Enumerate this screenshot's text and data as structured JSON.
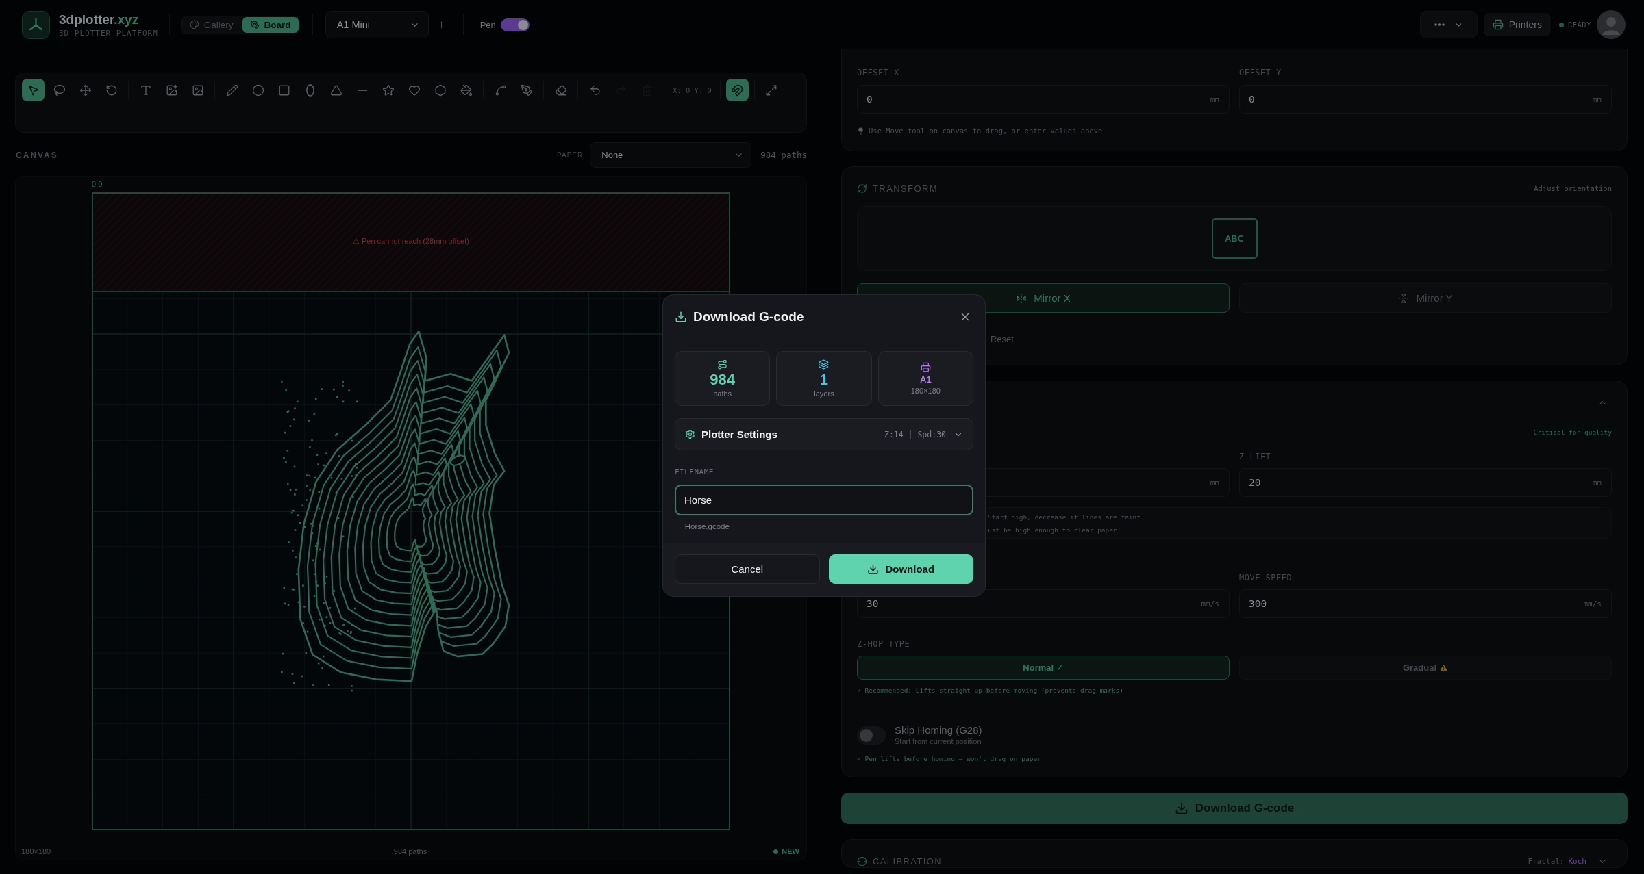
{
  "header": {
    "brand": {
      "name": "3dplotter",
      "suffix": ".xyz",
      "tagline": "3D PLOTTER PLATFORM"
    },
    "view_tabs": [
      {
        "label": "Gallery",
        "selected": false
      },
      {
        "label": "Board",
        "selected": true
      }
    ],
    "printer_select": {
      "value": "A1 Mini"
    },
    "pen": {
      "label": "Pen",
      "on": true
    },
    "printers_button": {
      "label": "Printers"
    },
    "status": {
      "label": "READY"
    }
  },
  "toolbar": {
    "groups": [
      {
        "kind": "tools",
        "tools": [
          {
            "selected": true,
            "disabled": false
          },
          {
            "selected": false,
            "disabled": false
          },
          {
            "selected": false,
            "disabled": false
          },
          {
            "selected": false,
            "disabled": false
          }
        ]
      },
      {
        "kind": "tools",
        "tools": [
          {
            "selected": false,
            "disabled": false
          },
          {
            "selected": false,
            "disabled": false
          },
          {
            "selected": false,
            "disabled": false
          }
        ]
      },
      {
        "kind": "tools",
        "tools": [
          {
            "selected": false,
            "disabled": false
          },
          {
            "selected": false,
            "disabled": false
          },
          {
            "selected": false,
            "disabled": false
          },
          {
            "selected": false,
            "disabled": false
          },
          {
            "selected": false,
            "disabled": false
          },
          {
            "selected": false,
            "disabled": false
          },
          {
            "selected": false,
            "disabled": false
          },
          {
            "selected": false,
            "disabled": false
          },
          {
            "selected": false,
            "disabled": false
          },
          {
            "selected": false,
            "disabled": false
          }
        ]
      },
      {
        "kind": "tools",
        "tools": [
          {
            "selected": false,
            "disabled": false
          },
          {
            "selected": false,
            "disabled": false
          }
        ]
      },
      {
        "kind": "tools",
        "tools": [
          {
            "selected": false,
            "disabled": false
          }
        ]
      },
      {
        "kind": "tools",
        "tools": [
          {
            "selected": false,
            "disabled": false
          },
          {
            "selected": false,
            "disabled": true
          },
          {
            "selected": false,
            "disabled": true
          }
        ]
      },
      {
        "kind": "readout",
        "text": "X: 0 Y: 0"
      },
      {
        "kind": "tools",
        "tools": [
          {
            "selected": true,
            "disabled": false
          }
        ]
      },
      {
        "kind": "tools",
        "tools": [
          {
            "selected": false,
            "disabled": false
          }
        ]
      }
    ]
  },
  "canvas": {
    "label": "CANVAS",
    "paper_label": "PAPER",
    "paper_value": "None",
    "path_count": "984 paths",
    "origin_label": "0,0",
    "warning": "⚠ Pen cannot reach (28mm offset)",
    "size": "180×180",
    "footer_paths": "984 paths",
    "status": "NEW"
  },
  "offset": {
    "fields": [
      {
        "label": "OFFSET X",
        "value": "0",
        "unit": "mm"
      },
      {
        "label": "OFFSET Y",
        "value": "0",
        "unit": "mm"
      }
    ],
    "hint": "Use Move tool on canvas to drag, or enter values above"
  },
  "transform": {
    "title": "TRANSFORM",
    "subtitle": "Adjust orientation",
    "preview_text": "ABC",
    "mirror_buttons": [
      {
        "label": "Mirror X",
        "selected": true
      },
      {
        "label": "Mirror Y",
        "selected": false
      }
    ],
    "reset": {
      "label": "Reset"
    }
  },
  "pen_settings": {
    "expanded": true,
    "note": "Critical for quality",
    "z_fields": [
      {
        "unit": "mm"
      },
      {
        "label": "Z-LIFT",
        "value": "20",
        "unit": "mm"
      }
    ],
    "hints": [
      "Start high, decrease if lines are faint.",
      "ust be high enough to clear paper!"
    ],
    "speed_fields": [
      {
        "value": "30",
        "unit": "mm/s"
      },
      {
        "label": "MOVE SPEED",
        "value": "300",
        "unit": "mm/s"
      }
    ],
    "zhop": {
      "label": "Z-HOP TYPE",
      "options": [
        {
          "kind": "normal",
          "label": "Normal ✓",
          "selected": true
        },
        {
          "kind": "warning",
          "label": "Gradual",
          "selected": false
        }
      ],
      "hint": "✓ Recommended: Lifts straight up before moving (prevents drag marks)"
    },
    "skip_homing": {
      "title": "Skip Homing (G28)",
      "subtitle": "Start from current position",
      "on": false
    },
    "homing_hint": "✓ Pen lifts before homing — won't drag on paper"
  },
  "download_button": {
    "label": "Download G-code"
  },
  "calibration": {
    "title": "CALIBRATION",
    "fractal_label": "Fractal:",
    "fractal_value": "Koch",
    "expanded": false
  },
  "dialog": {
    "title": "Download G-code",
    "stats": [
      {
        "kind": "paths",
        "value": "984",
        "caption": "paths"
      },
      {
        "kind": "layers",
        "value": "1",
        "caption": "layers"
      },
      {
        "kind": "printer",
        "value": "A1",
        "caption": "180×180"
      }
    ],
    "settings": {
      "label": "Plotter Settings",
      "summary": "Z:14 | Spd:30",
      "expanded": false
    },
    "filename": {
      "label": "FILENAME",
      "value": "Horse"
    },
    "output_name": "→ Horse.gcode",
    "buttons": [
      {
        "kind": "cancel",
        "label": "Cancel"
      },
      {
        "kind": "primary",
        "label": "Download"
      }
    ]
  }
}
